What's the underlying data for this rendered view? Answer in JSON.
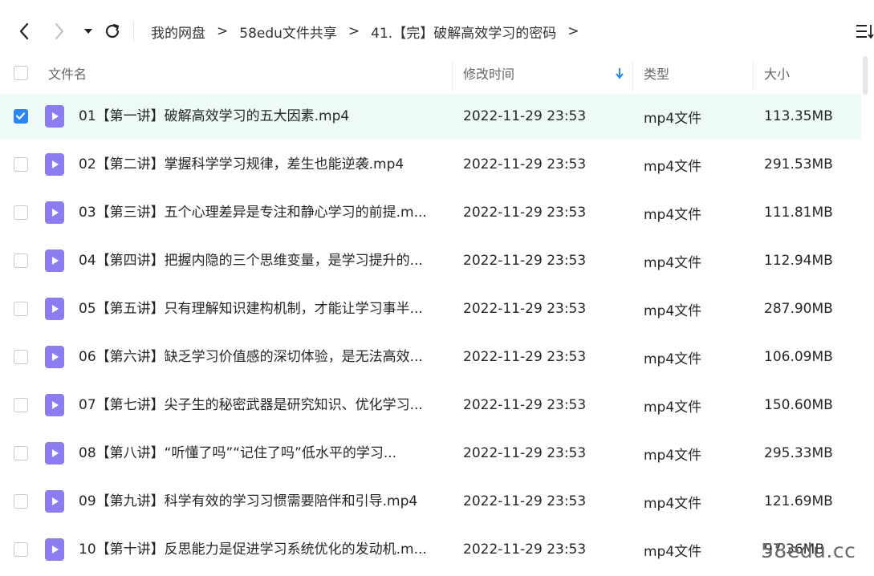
{
  "breadcrumb": [
    {
      "label": "我的网盘"
    },
    {
      "label": "58edu文件共享"
    },
    {
      "label": "41.【完】破解高效学习的密码"
    }
  ],
  "separator": ">",
  "columns": {
    "name": "文件名",
    "modified": "修改时间",
    "type": "类型",
    "size": "大小"
  },
  "files": [
    {
      "name": "01【第一讲】破解高效学习的五大因素.mp4",
      "time": "2022-11-29 23:53",
      "type": "mp4文件",
      "size": "113.35MB",
      "selected": true
    },
    {
      "name": "02【第二讲】掌握科学学习规律，差生也能逆袭.mp4",
      "time": "2022-11-29 23:53",
      "type": "mp4文件",
      "size": "291.53MB",
      "selected": false
    },
    {
      "name": "03【第三讲】五个心理差异是专注和静心学习的前提.m...",
      "time": "2022-11-29 23:53",
      "type": "mp4文件",
      "size": "111.81MB",
      "selected": false
    },
    {
      "name": "04【第四讲】把握内隐的三个思维变量，是学习提升的...",
      "time": "2022-11-29 23:53",
      "type": "mp4文件",
      "size": "112.94MB",
      "selected": false
    },
    {
      "name": "05【第五讲】只有理解知识建构机制，才能让学习事半...",
      "time": "2022-11-29 23:53",
      "type": "mp4文件",
      "size": "287.90MB",
      "selected": false
    },
    {
      "name": "06【第六讲】缺乏学习价值感的深切体验，是无法高效...",
      "time": "2022-11-29 23:53",
      "type": "mp4文件",
      "size": "106.09MB",
      "selected": false
    },
    {
      "name": "07【第七讲】尖子生的秘密武器是研究知识、优化学习...",
      "time": "2022-11-29 23:53",
      "type": "mp4文件",
      "size": "150.60MB",
      "selected": false
    },
    {
      "name": "08【第八讲】“听懂了吗”“记住了吗”低水平的学习...",
      "time": "2022-11-29 23:53",
      "type": "mp4文件",
      "size": "295.33MB",
      "selected": false
    },
    {
      "name": "09【第九讲】科学有效的学习习惯需要陪伴和引导.mp4",
      "time": "2022-11-29 23:53",
      "type": "mp4文件",
      "size": "121.69MB",
      "selected": false
    },
    {
      "name": "10【第十讲】反思能力是促进学习系统优化的发动机.m...",
      "time": "2022-11-29 23:53",
      "type": "mp4文件",
      "size": "97.36MB",
      "selected": false
    }
  ],
  "watermark": "58edu.cc",
  "colors": {
    "accent": "#2a86f5",
    "file_icon": "#8b7cf0",
    "selected_row": "#eefaf8"
  }
}
